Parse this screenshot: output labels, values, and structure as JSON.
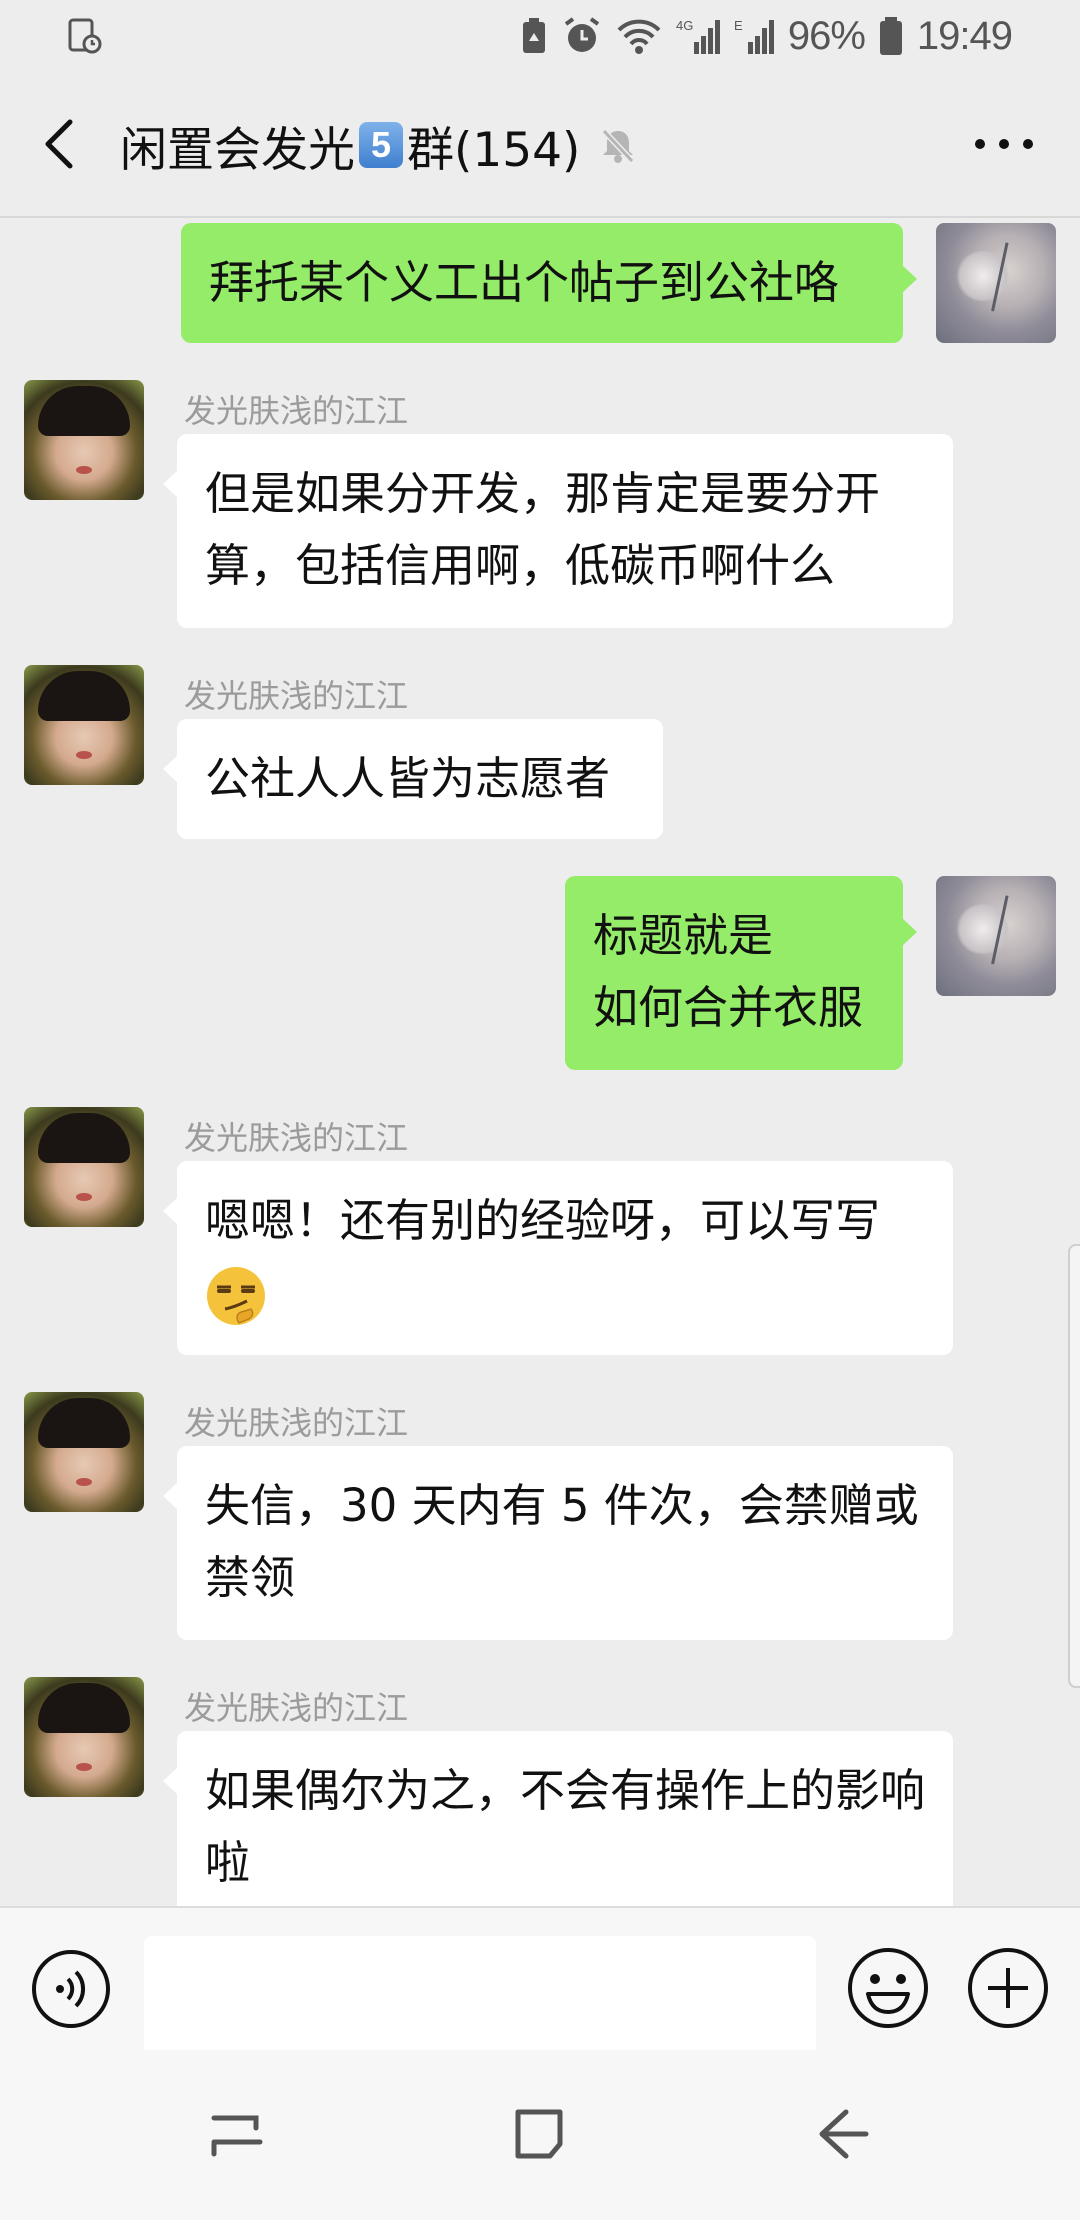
{
  "status_bar": {
    "battery_pct": "96%",
    "time": "19:49",
    "icons": [
      "screenshot-icon",
      "battery-saver-icon",
      "alarm-icon",
      "wifi-icon",
      "signal-4g-icon",
      "signal-e-icon",
      "battery-icon"
    ],
    "network_4g": "4G",
    "network_e": "E"
  },
  "header": {
    "title_prefix": "闲置会发光",
    "title_badge": "5",
    "title_suffix": "群(154)",
    "mute": true
  },
  "messages": [
    {
      "direction": "out",
      "text": "拜托某个义工出个帖子到公社咯"
    },
    {
      "direction": "in",
      "sender": "发光肤浅的江江",
      "text": "但是如果分开发，那肯定是要分开算，包括信用啊，低碳币啊什么"
    },
    {
      "direction": "in",
      "sender": "发光肤浅的江江",
      "text": "公社人人皆为志愿者"
    },
    {
      "direction": "out",
      "text": "标题就是\n如何合并衣服"
    },
    {
      "direction": "in",
      "sender": "发光肤浅的江江",
      "text": "嗯嗯！还有别的经验呀，可以写写",
      "emoji": "smirk-emoji"
    },
    {
      "direction": "in",
      "sender": "发光肤浅的江江",
      "text": "失信，30 天内有 5 件次，会禁赠或禁领"
    },
    {
      "direction": "in",
      "sender": "发光肤浅的江江",
      "text": "如果偶尔为之，不会有操作上的影响啦"
    }
  ],
  "input_bar": {
    "text_value": "",
    "placeholder": ""
  },
  "colors": {
    "background": "#ededed",
    "bubble_out": "#95ec69",
    "bubble_in": "#ffffff",
    "sender_name": "#9b9b9b"
  }
}
